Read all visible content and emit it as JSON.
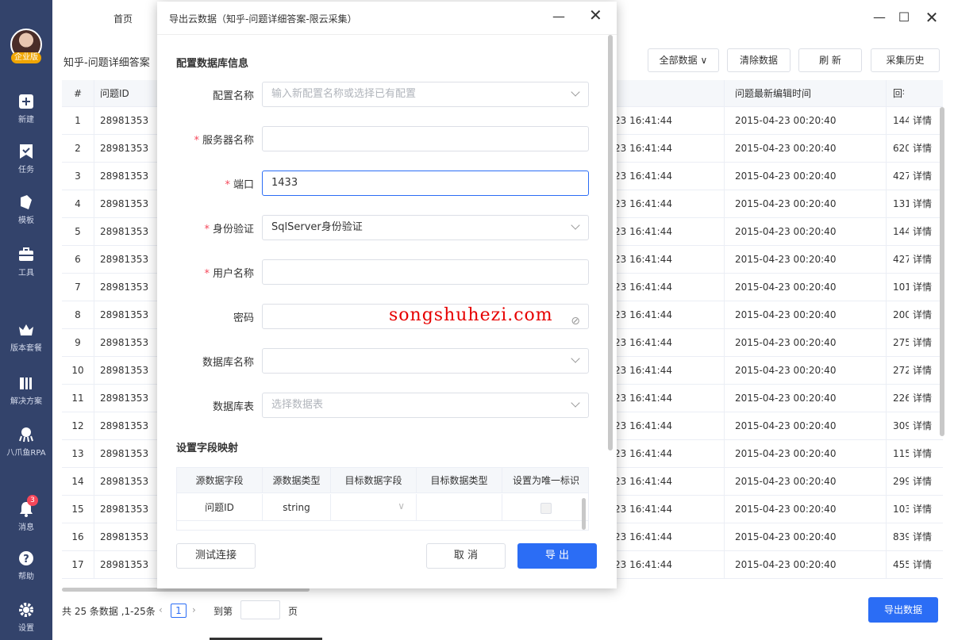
{
  "sidebar": {
    "badge": "企业版",
    "items": [
      {
        "label": "新建",
        "icon": "plus-icon"
      },
      {
        "label": "任务",
        "icon": "task-icon"
      },
      {
        "label": "模板",
        "icon": "template-icon"
      },
      {
        "label": "工具",
        "icon": "toolbox-icon"
      },
      {
        "label": "版本套餐",
        "icon": "crown-icon"
      },
      {
        "label": "解决方案",
        "icon": "solution-icon"
      },
      {
        "label": "八爪鱼RPA",
        "icon": "octopus-icon"
      },
      {
        "label": "消息",
        "icon": "bell-icon",
        "badge": "3"
      },
      {
        "label": "帮助",
        "icon": "help-icon"
      },
      {
        "label": "设置",
        "icon": "gear-icon"
      }
    ]
  },
  "topbar": {
    "tab": "首页"
  },
  "page": {
    "title": "知乎-问题详细答案",
    "buttons": {
      "filter": "全部数据",
      "clear": "清除数据",
      "refresh": "刷 新",
      "history": "采集历史"
    }
  },
  "table": {
    "headers": {
      "index": "#",
      "id": "问题ID",
      "edit_time": "问题最新编辑时间",
      "answer": "回答"
    },
    "detail_label": "详情",
    "rows": [
      {
        "n": "1",
        "id": "28981353",
        "time": "23 16:41:44",
        "edit": "2015-04-23 00:20:40",
        "ans": "144"
      },
      {
        "n": "2",
        "id": "28981353",
        "time": "23 16:41:44",
        "edit": "2015-04-23 00:20:40",
        "ans": "620"
      },
      {
        "n": "3",
        "id": "28981353",
        "time": "23 16:41:44",
        "edit": "2015-04-23 00:20:40",
        "ans": "427"
      },
      {
        "n": "4",
        "id": "28981353",
        "time": "23 16:41:44",
        "edit": "2015-04-23 00:20:40",
        "ans": "131"
      },
      {
        "n": "5",
        "id": "28981353",
        "time": "23 16:41:44",
        "edit": "2015-04-23 00:20:40",
        "ans": "144"
      },
      {
        "n": "6",
        "id": "28981353",
        "time": "23 16:41:44",
        "edit": "2015-04-23 00:20:40",
        "ans": "427"
      },
      {
        "n": "7",
        "id": "28981353",
        "time": "23 16:41:44",
        "edit": "2015-04-23 00:20:40",
        "ans": "101"
      },
      {
        "n": "8",
        "id": "28981353",
        "time": "23 16:41:44",
        "edit": "2015-04-23 00:20:40",
        "ans": "200"
      },
      {
        "n": "9",
        "id": "28981353",
        "time": "23 16:41:44",
        "edit": "2015-04-23 00:20:40",
        "ans": "275"
      },
      {
        "n": "10",
        "id": "28981353",
        "time": "23 16:41:44",
        "edit": "2015-04-23 00:20:40",
        "ans": "272"
      },
      {
        "n": "11",
        "id": "28981353",
        "time": "23 16:41:44",
        "edit": "2015-04-23 00:20:40",
        "ans": "226"
      },
      {
        "n": "12",
        "id": "28981353",
        "time": "23 16:41:44",
        "edit": "2015-04-23 00:20:40",
        "ans": "309"
      },
      {
        "n": "13",
        "id": "28981353",
        "time": "23 16:41:44",
        "edit": "2015-04-23 00:20:40",
        "ans": "115"
      },
      {
        "n": "14",
        "id": "28981353",
        "time": "23 16:41:44",
        "edit": "2015-04-23 00:20:40",
        "ans": "299"
      },
      {
        "n": "15",
        "id": "28981353",
        "time": "23 16:41:44",
        "edit": "2015-04-23 00:20:40",
        "ans": "103"
      },
      {
        "n": "16",
        "id": "28981353",
        "time": "23 16:41:44",
        "edit": "2015-04-23 00:20:40",
        "ans": "839"
      },
      {
        "n": "17",
        "id": "28981353",
        "time": "23 16:41:44",
        "edit": "2015-04-23 00:20:40",
        "ans": "455"
      }
    ]
  },
  "footer": {
    "total": "共 25 条数据 ,1-25条",
    "current_page": "1",
    "goto_label": "到第",
    "page_label": "页",
    "export_button": "导出数据"
  },
  "dialog": {
    "title": "导出云数据（知乎-问题详细答案-限云采集）",
    "section_db": "配置数据库信息",
    "fields": {
      "config_name": {
        "label": "配置名称",
        "placeholder": "输入新配置名称或选择已有配置"
      },
      "server_name": {
        "label": "服务器名称",
        "value": ""
      },
      "port": {
        "label": "端口",
        "value": "1433"
      },
      "auth": {
        "label": "身份验证",
        "value": "SqlServer身份验证"
      },
      "username": {
        "label": "用户名称",
        "value": ""
      },
      "password": {
        "label": "密码",
        "value": ""
      },
      "db_name": {
        "label": "数据库名称",
        "value": ""
      },
      "db_table": {
        "label": "数据库表",
        "placeholder": "选择数据表"
      }
    },
    "watermark": "songshuhezi.com",
    "section_mapping": "设置字段映射",
    "mapping": {
      "headers": [
        "源数据字段",
        "源数据类型",
        "目标数据字段",
        "目标数据类型",
        "设置为唯一标识"
      ],
      "rows": [
        {
          "field": "问题ID",
          "type": "string"
        }
      ]
    },
    "buttons": {
      "test": "测试连接",
      "cancel": "取 消",
      "export": "导 出"
    }
  },
  "colors": {
    "sidebar": "#33436b",
    "primary": "#2b6df5",
    "required": "#f5475a"
  }
}
